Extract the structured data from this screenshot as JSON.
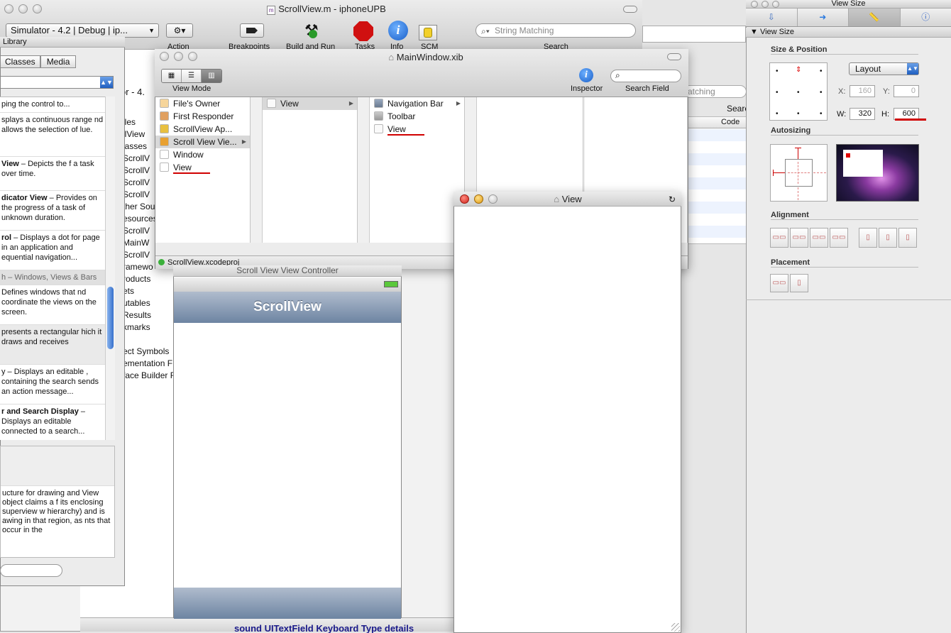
{
  "xcode": {
    "title": "ScrollView.m - iphoneUPB",
    "scheme": "Simulator - 4.2 | Debug | ip...",
    "toolbar": [
      "Action",
      "Breakpoints",
      "Build and Run",
      "Tasks",
      "Info",
      "SCM",
      "Search"
    ],
    "search_placeholder": "String Matching",
    "search2_placeholder": "atching",
    "search_label2": "Searc",
    "code_header": "Code",
    "bottom_text": "sound UITextField Keyboard Type details",
    "groups": [
      "iles",
      "llView",
      "lasses",
      "ScrollV",
      "ScrollV",
      "ScrollV",
      "ScrollV",
      "ther Sou",
      "esources",
      "ScrollV",
      "MainW",
      "ScrollV",
      "ramewo",
      "roducts",
      "ets",
      "utables",
      "Results",
      "kmarks",
      "",
      "ect Symbols",
      "ementation F",
      "face Builder F"
    ],
    "sub": "or - 4."
  },
  "library": {
    "title": "Library",
    "tabs": [
      "Classes",
      "Media"
    ],
    "items": [
      {
        "bold": "",
        "text": "ping the control to..."
      },
      {
        "bold": "",
        "text": "splays a continuous range nd allows the selection of lue."
      },
      {
        "bold": "View",
        "text": " – Depicts the f a task over time."
      },
      {
        "bold": "dicator View",
        "text": " – Provides on the progress of a task of unknown duration."
      },
      {
        "bold": "rol",
        "text": " – Displays a dot for page in an application and equential navigation..."
      },
      {
        "bold": "",
        "text": "h – Windows, Views & Bars"
      },
      {
        "bold": "",
        "text": " Defines windows that nd coordinate the views on the screen."
      },
      {
        "bold": "",
        "text": "presents a rectangular hich it draws and receives"
      },
      {
        "bold": "",
        "text": "y – Displays an editable , containing the search sends an action message..."
      },
      {
        "bold": "r and Search Display",
        "text": " – Displays an editable connected to a search..."
      }
    ],
    "desc": "ucture for drawing and View object claims a f its enclosing superview w hierarchy) and is awing in that region, as nts that occur in the"
  },
  "xib": {
    "title": "MainWindow.xib",
    "view_mode": "View Mode",
    "inspector": "Inspector",
    "search_field": "Search Field",
    "col1": [
      "File's Owner",
      "First Responder",
      "ScrollView Ap...",
      "Scroll View Vie...",
      "Window",
      "View"
    ],
    "col2": [
      "View"
    ],
    "col3": [
      "Navigation Bar",
      "Toolbar",
      "View"
    ],
    "status": "ScrollView.xcodeproj"
  },
  "vc": {
    "title": "Scroll View View Controller",
    "nav": "ScrollView"
  },
  "viewwin": {
    "title": "View"
  },
  "inspector": {
    "title": "View Size",
    "section": "View Size",
    "size_position": "Size & Position",
    "layout": "Layout",
    "x_label": "X:",
    "x": "160",
    "y_label": "Y:",
    "y": "0",
    "w_label": "W:",
    "w": "320",
    "h_label": "H:",
    "h": "600",
    "autosizing": "Autosizing",
    "alignment": "Alignment",
    "placement": "Placement"
  }
}
